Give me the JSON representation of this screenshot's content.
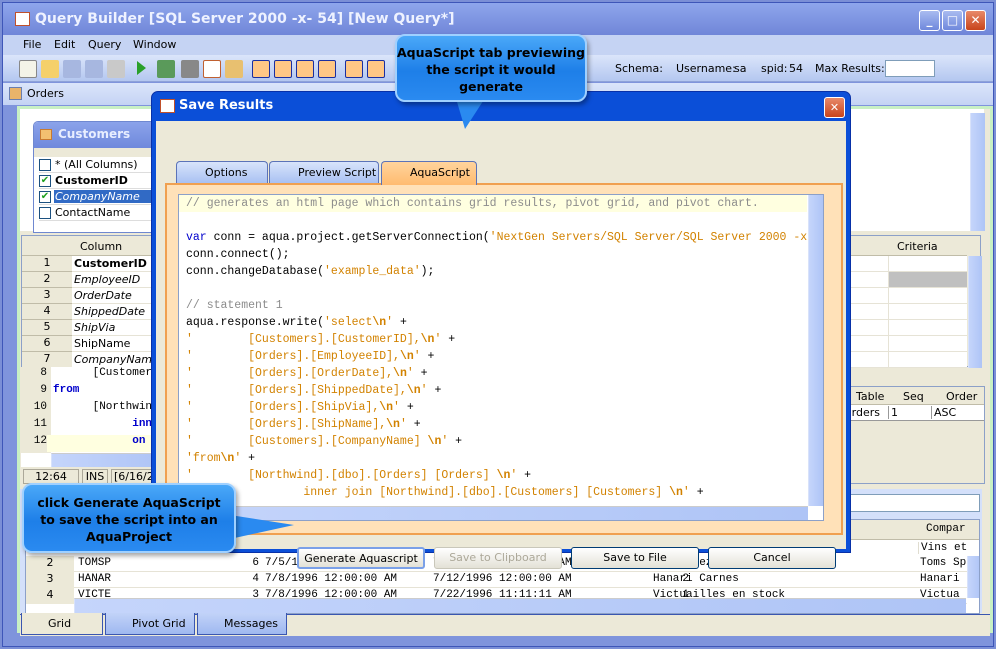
{
  "window": {
    "title": "Query Builder [SQL Server 2000 -x- 54] [New Query*]"
  },
  "menu": [
    "File",
    "Edit",
    "Query",
    "Window"
  ],
  "toolbar": {
    "schema_label": "Schema:",
    "username_label": "Username:",
    "username": "sa",
    "spid_label": "spid:",
    "spid": "54",
    "max_results_label": "Max Results:",
    "max_results": ""
  },
  "doc_tab": "Orders",
  "customers_table": {
    "title": "Customers",
    "columns": [
      {
        "name": "* (All Columns)",
        "checked": false,
        "style": "normal"
      },
      {
        "name": "CustomerID",
        "checked": true,
        "style": "bold"
      },
      {
        "name": "CompanyName",
        "checked": true,
        "style": "selected"
      },
      {
        "name": "ContactName",
        "checked": false,
        "style": "normal"
      }
    ]
  },
  "criteria_grid": {
    "headers": {
      "column": "Column",
      "criteria": "Criteria"
    },
    "rows": [
      {
        "n": "1",
        "col": "CustomerID",
        "style": "bold"
      },
      {
        "n": "2",
        "col": "EmployeeID",
        "style": "italic"
      },
      {
        "n": "3",
        "col": "OrderDate",
        "style": "italic"
      },
      {
        "n": "4",
        "col": "ShippedDate",
        "style": "italic"
      },
      {
        "n": "5",
        "col": "ShipVia",
        "style": "italic"
      },
      {
        "n": "6",
        "col": "ShipName",
        "style": "normal"
      },
      {
        "n": "7",
        "col": "CompanyName",
        "style": "italic"
      }
    ]
  },
  "sql_editor": {
    "lines": [
      {
        "n": "8",
        "t": "      [Customer",
        "kw": false
      },
      {
        "n": "9",
        "t": "from",
        "kw": true
      },
      {
        "n": "10",
        "t": "      [Northwin",
        "kw": false
      },
      {
        "n": "11",
        "t": "            inn",
        "kw": true
      },
      {
        "n": "12",
        "t": "            on",
        "kw": true
      }
    ]
  },
  "status": {
    "pos": "12:64",
    "mode": "INS",
    "date": "[6/16/20"
  },
  "sort_grid": {
    "headers": [
      "Table",
      "Seq",
      "Order"
    ],
    "rows": [
      [
        "Orders",
        "1",
        "ASC"
      ]
    ]
  },
  "results": {
    "header_last": "Compar",
    "rows": [
      {
        "n": "2",
        "id": "TOMSP",
        "emp": "6",
        "d1": "7/5/1996 12:00:00 AM",
        "d2": "7/10/1996 12:00:00 AM",
        "via": "1",
        "name": "Toms Spezialitäten",
        "comp": "Toms Sp"
      },
      {
        "n": "3",
        "id": "HANAR",
        "emp": "4",
        "d1": "7/8/1996 12:00:00 AM",
        "d2": "7/12/1996 12:00:00 AM",
        "via": "2",
        "name": "Hanari Carnes",
        "comp": "Hanari"
      },
      {
        "n": "4",
        "id": "VICTE",
        "emp": "3",
        "d1": "7/8/1996 12:00:00 AM",
        "d2": "7/22/1996 11:11:11 AM",
        "via": "1",
        "name": "Victuailles en stock",
        "comp": "Victua"
      }
    ],
    "row1_comp": "Vins et"
  },
  "bottom_tabs": [
    "Grid",
    "Pivot Grid",
    "Messages"
  ],
  "dialog": {
    "title": "Save Results",
    "tabs": [
      "Options",
      "Preview Script",
      "AquaScript"
    ],
    "active_tab": "AquaScript",
    "code": [
      [
        {
          "t": "// generates an html page which contains grid results, pivot grid, and pivot chart.",
          "c": "cmt"
        }
      ],
      [],
      [
        {
          "t": "var",
          "c": "kw"
        },
        {
          "t": " conn = aqua.project.getServerConnection(",
          "c": "plain"
        },
        {
          "t": "'NextGen Servers/SQL Server/SQL Server 2000 -x",
          "c": "str"
        }
      ],
      [
        {
          "t": "conn.connect();",
          "c": "plain"
        }
      ],
      [
        {
          "t": "conn.changeDatabase(",
          "c": "plain"
        },
        {
          "t": "'example_data'",
          "c": "str"
        },
        {
          "t": ");",
          "c": "plain"
        }
      ],
      [],
      [
        {
          "t": "// statement 1",
          "c": "cmt"
        }
      ],
      [
        {
          "t": "aqua.response.write(",
          "c": "plain"
        },
        {
          "t": "'select",
          "c": "str"
        },
        {
          "t": "\\n",
          "c": "esc"
        },
        {
          "t": "'",
          "c": "str"
        },
        {
          "t": " +",
          "c": "plain"
        }
      ],
      [
        {
          "t": "'        [Customers].[CustomerID],",
          "c": "str"
        },
        {
          "t": "\\n",
          "c": "esc"
        },
        {
          "t": "'",
          "c": "str"
        },
        {
          "t": " +",
          "c": "plain"
        }
      ],
      [
        {
          "t": "'        [Orders].[EmployeeID],",
          "c": "str"
        },
        {
          "t": "\\n",
          "c": "esc"
        },
        {
          "t": "'",
          "c": "str"
        },
        {
          "t": " +",
          "c": "plain"
        }
      ],
      [
        {
          "t": "'        [Orders].[OrderDate],",
          "c": "str"
        },
        {
          "t": "\\n",
          "c": "esc"
        },
        {
          "t": "'",
          "c": "str"
        },
        {
          "t": " +",
          "c": "plain"
        }
      ],
      [
        {
          "t": "'        [Orders].[ShippedDate],",
          "c": "str"
        },
        {
          "t": "\\n",
          "c": "esc"
        },
        {
          "t": "'",
          "c": "str"
        },
        {
          "t": " +",
          "c": "plain"
        }
      ],
      [
        {
          "t": "'        [Orders].[ShipVia],",
          "c": "str"
        },
        {
          "t": "\\n",
          "c": "esc"
        },
        {
          "t": "'",
          "c": "str"
        },
        {
          "t": " +",
          "c": "plain"
        }
      ],
      [
        {
          "t": "'        [Orders].[ShipName],",
          "c": "str"
        },
        {
          "t": "\\n",
          "c": "esc"
        },
        {
          "t": "'",
          "c": "str"
        },
        {
          "t": " +",
          "c": "plain"
        }
      ],
      [
        {
          "t": "'        [Customers].[CompanyName] ",
          "c": "str"
        },
        {
          "t": "\\n",
          "c": "esc"
        },
        {
          "t": "'",
          "c": "str"
        },
        {
          "t": " +",
          "c": "plain"
        }
      ],
      [
        {
          "t": "'from",
          "c": "str"
        },
        {
          "t": "\\n",
          "c": "esc"
        },
        {
          "t": "'",
          "c": "str"
        },
        {
          "t": " +",
          "c": "plain"
        }
      ],
      [
        {
          "t": "'        [Northwind].[dbo].[Orders] [Orders] ",
          "c": "str"
        },
        {
          "t": "\\n",
          "c": "esc"
        },
        {
          "t": "'",
          "c": "str"
        },
        {
          "t": " +",
          "c": "plain"
        }
      ],
      [
        {
          "t": "'                inner join [Northwind].[dbo].[Customers] [Customers] ",
          "c": "str"
        },
        {
          "t": "\\n",
          "c": "esc"
        },
        {
          "t": "'",
          "c": "str"
        },
        {
          "t": " +",
          "c": "plain"
        }
      ]
    ],
    "buttons": {
      "generate": "Generate Aquascript",
      "clipboard": "Save to Clipboard",
      "file": "Save to File",
      "cancel": "Cancel"
    }
  },
  "callouts": {
    "top": "AquaScript tab previewing the script it would generate",
    "bottom": "click Generate AquaScript to save the script into an AquaProject"
  }
}
